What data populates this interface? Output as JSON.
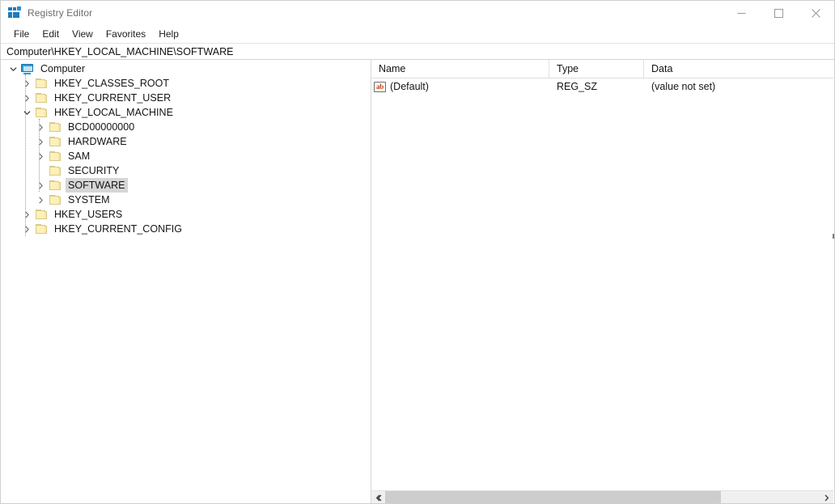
{
  "window": {
    "title": "Registry Editor",
    "app_icon": "registry-editor-icon",
    "controls": {
      "minimize": "minimize-icon",
      "maximize": "maximize-icon",
      "close": "close-icon"
    }
  },
  "menubar": {
    "items": [
      {
        "label": "File"
      },
      {
        "label": "Edit"
      },
      {
        "label": "View"
      },
      {
        "label": "Favorites"
      },
      {
        "label": "Help"
      }
    ]
  },
  "address": {
    "path": "Computer\\HKEY_LOCAL_MACHINE\\SOFTWARE"
  },
  "tree": {
    "nodes": [
      {
        "label": "Computer",
        "depth": 0,
        "icon": "monitor-icon",
        "expander": "expanded",
        "selected": false
      },
      {
        "label": "HKEY_CLASSES_ROOT",
        "depth": 1,
        "icon": "folder-icon",
        "expander": "collapsed",
        "selected": false
      },
      {
        "label": "HKEY_CURRENT_USER",
        "depth": 1,
        "icon": "folder-icon",
        "expander": "collapsed",
        "selected": false
      },
      {
        "label": "HKEY_LOCAL_MACHINE",
        "depth": 1,
        "icon": "folder-icon",
        "expander": "expanded",
        "selected": false
      },
      {
        "label": "BCD00000000",
        "depth": 2,
        "icon": "folder-icon",
        "expander": "collapsed",
        "selected": false
      },
      {
        "label": "HARDWARE",
        "depth": 2,
        "icon": "folder-icon",
        "expander": "collapsed",
        "selected": false
      },
      {
        "label": "SAM",
        "depth": 2,
        "icon": "folder-icon",
        "expander": "collapsed",
        "selected": false
      },
      {
        "label": "SECURITY",
        "depth": 2,
        "icon": "folder-icon",
        "expander": "none",
        "selected": false
      },
      {
        "label": "SOFTWARE",
        "depth": 2,
        "icon": "folder-icon",
        "expander": "collapsed",
        "selected": true
      },
      {
        "label": "SYSTEM",
        "depth": 2,
        "icon": "folder-icon",
        "expander": "collapsed",
        "selected": false
      },
      {
        "label": "HKEY_USERS",
        "depth": 1,
        "icon": "folder-icon",
        "expander": "collapsed",
        "selected": false
      },
      {
        "label": "HKEY_CURRENT_CONFIG",
        "depth": 1,
        "icon": "folder-icon",
        "expander": "collapsed",
        "selected": false
      }
    ]
  },
  "list": {
    "columns": [
      {
        "label": "Name"
      },
      {
        "label": "Type"
      },
      {
        "label": "Data"
      }
    ],
    "rows": [
      {
        "icon": "string-value-icon",
        "name": "(Default)",
        "type": "REG_SZ",
        "data": "(value not set)"
      }
    ]
  },
  "scrollbar": {
    "left_arrow": "chevron-left-icon",
    "right_arrow": "chevron-right-icon"
  },
  "colors": {
    "selection": "#d6d6d6",
    "folder": "#fdf0b8",
    "accent": "#1e7bbd",
    "value_icon_text": "#c1440e"
  }
}
